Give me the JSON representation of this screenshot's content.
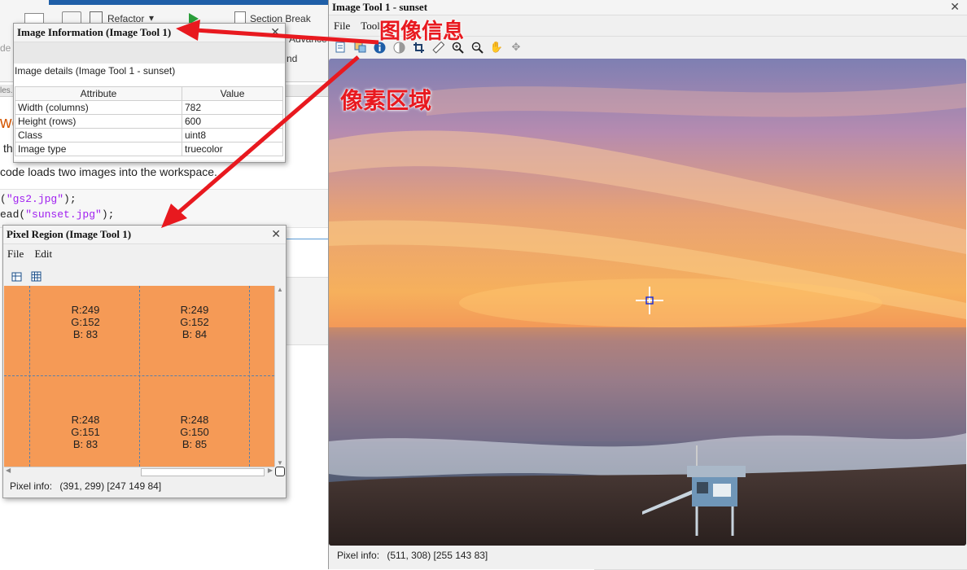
{
  "editor": {
    "refactor_label": "Refactor",
    "section_break_label": "Section Break",
    "advance_label": "Advance",
    "nd_label": "nd",
    "partial_tab": "les.",
    "heading_fragment": "we",
    "text_fragment": "th",
    "sentence": "code loads two images into the workspace.",
    "code_line1_prefix": "(",
    "code_line1_str": "\"gs2.jpg\"",
    "code_line1_suffix": ");",
    "code_line2_prefix": "ead(",
    "code_line2_str": "\"sunset.jpg\"",
    "code_line2_suffix": ");"
  },
  "image_info": {
    "title": "Image Information (Image Tool 1)",
    "details": "Image details  (Image Tool 1 - sunset)",
    "columns": [
      "Attribute",
      "Value"
    ],
    "rows": [
      [
        "Width (columns)",
        "782"
      ],
      [
        "Height (rows)",
        "600"
      ],
      [
        "Class",
        "uint8"
      ],
      [
        "Image type",
        "truecolor"
      ]
    ]
  },
  "pixel_region": {
    "title": "Pixel Region (Image Tool 1)",
    "menu": [
      "File",
      "Edit"
    ],
    "cells": [
      [
        "R:249",
        "G:152",
        "B: 83"
      ],
      [
        "R:249",
        "G:152",
        "B: 84"
      ],
      [
        "R:248",
        "G:151",
        "B: 83"
      ],
      [
        "R:248",
        "G:150",
        "B: 85"
      ]
    ],
    "pixel_info_label": "Pixel info:",
    "pixel_info_value": "(391, 299)  [247 149 84]"
  },
  "image_tool": {
    "title": "Image Tool 1 - sunset",
    "menu": [
      "File",
      "Tool"
    ],
    "pixel_info_label": "Pixel info:",
    "pixel_info_value": "(511, 308)  [255 143 83]"
  },
  "annotations": {
    "image_info_label": "图像信息",
    "pixel_region_label": "像素区域"
  },
  "colors": {
    "annotation": "#e8191f",
    "pixel_region_fill": "#f59a56"
  }
}
